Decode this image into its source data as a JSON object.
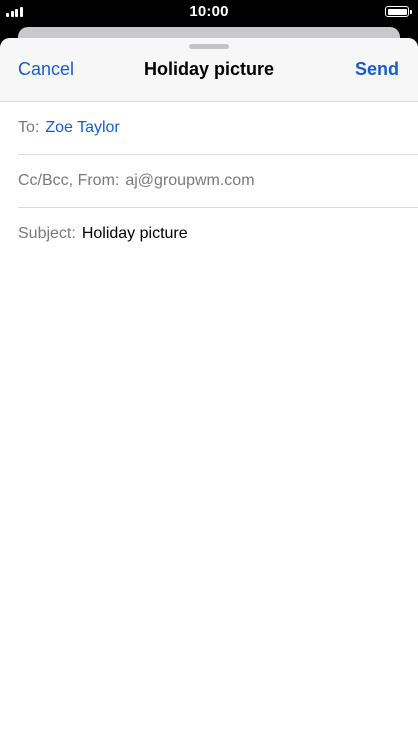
{
  "status_bar": {
    "time": "10:00"
  },
  "nav": {
    "cancel_label": "Cancel",
    "title": "Holiday picture",
    "send_label": "Send"
  },
  "fields": {
    "to_label": "To:",
    "to_value": "Zoe Taylor",
    "ccbcc_label": "Cc/Bcc, From:",
    "from_value": "aj@groupwm.com",
    "subject_label": "Subject:",
    "subject_value": "Holiday picture"
  },
  "colors": {
    "accent": "#1a5cc8",
    "secondary_text": "#7a7a7a"
  }
}
